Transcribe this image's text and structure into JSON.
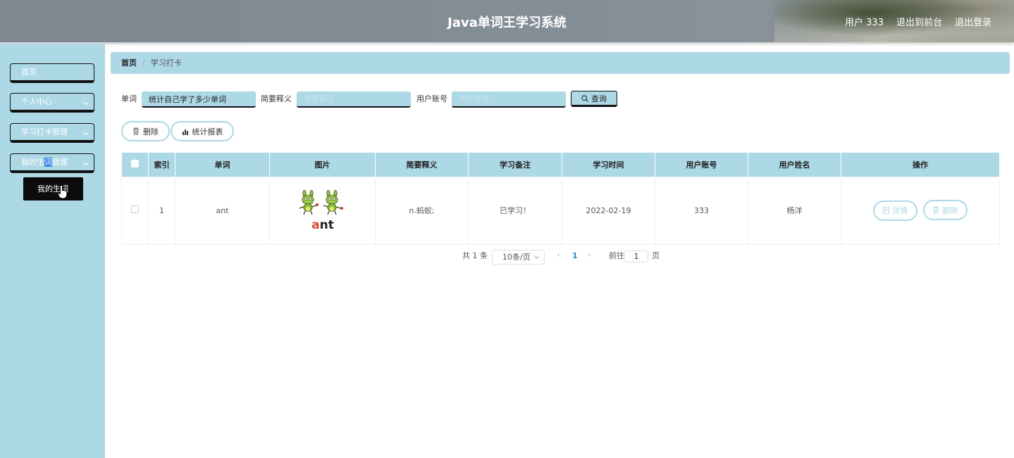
{
  "header": {
    "title": "Java单词王学习系统",
    "user": "用户 333",
    "to_front": "退出到前台",
    "logout": "退出登录"
  },
  "sidebar": {
    "items": [
      {
        "label": "首页"
      },
      {
        "label": "个人中心"
      },
      {
        "label": "学习打卡管理"
      },
      {
        "label_a": "我的生",
        "label_b": "词",
        "label_c": "管理"
      }
    ],
    "submenu": "我的生词"
  },
  "breadcrumb": {
    "home": "首页",
    "separator": "/",
    "current": "学习打卡"
  },
  "search": {
    "word_label": "单词",
    "word_value": "统计自己学了多少单词",
    "meaning_label": "简要释义",
    "meaning_placeholder": "简要释义",
    "account_label": "用户账号",
    "account_placeholder": "用户账号",
    "query_button": "查询"
  },
  "actions": {
    "delete": "删除",
    "report": "统计报表"
  },
  "table": {
    "headers": [
      "索引",
      "单词",
      "图片",
      "简要释义",
      "学习备注",
      "学习时间",
      "用户账号",
      "用户姓名",
      "操作"
    ],
    "rows": [
      {
        "index": "1",
        "word": "ant",
        "image_caption": "ant",
        "meaning": "n.蚂蚁;",
        "note": "已学习！",
        "time": "2022-02-19",
        "account": "333",
        "name": "杨洋",
        "detail": "详情",
        "delete": "删除"
      }
    ]
  },
  "pagination": {
    "total": "共 1 条",
    "page_size": "10条/页",
    "current": "1",
    "goto_label": "前往",
    "goto_value": "1",
    "page_suffix": "页"
  },
  "colors": {
    "accent": "#add8e6",
    "dark": "#111111"
  }
}
